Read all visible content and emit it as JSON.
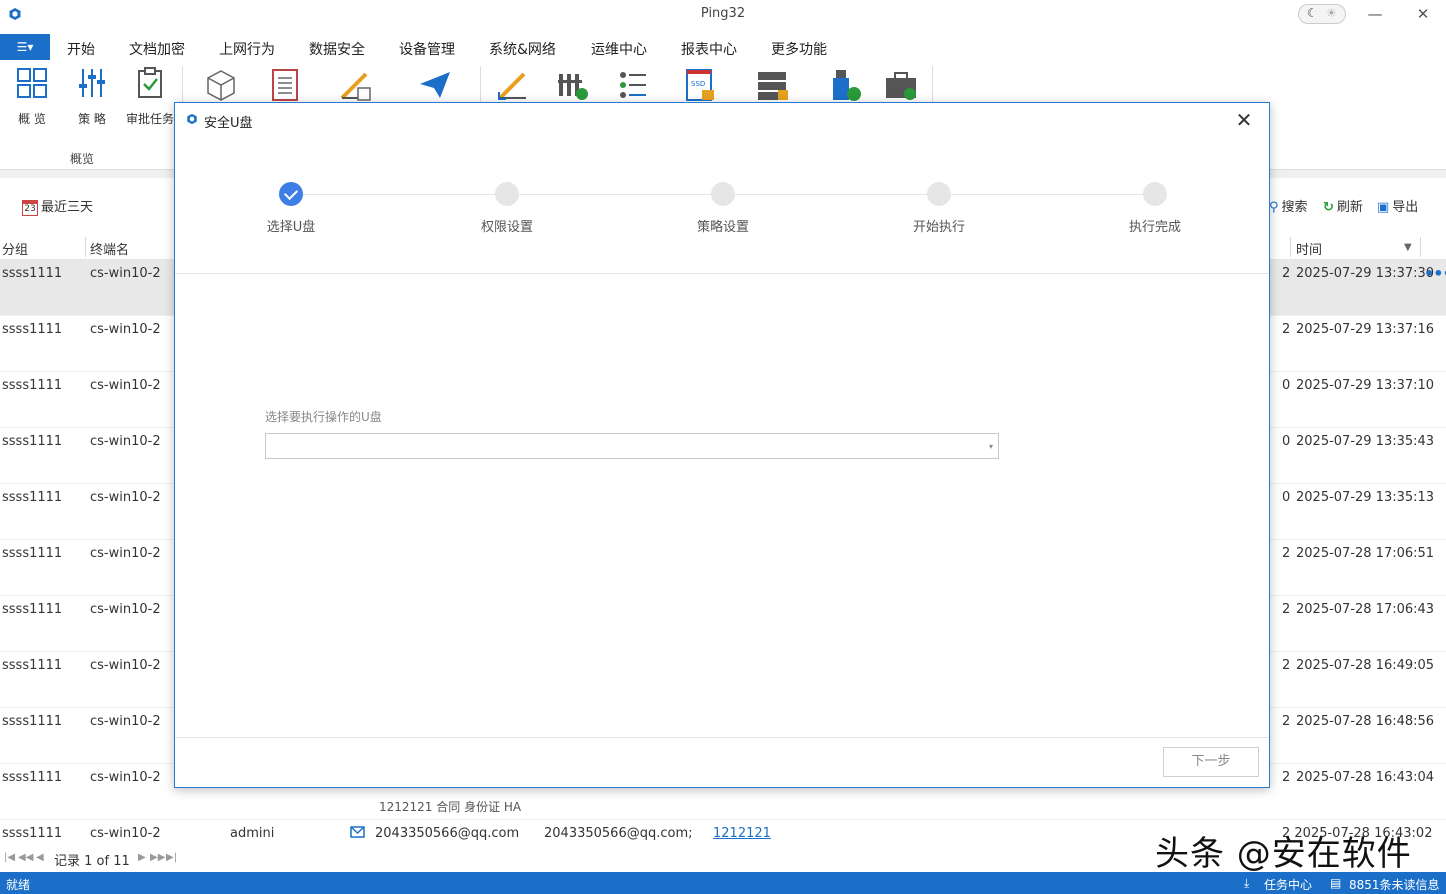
{
  "app": {
    "title": "Ping32"
  },
  "window": {
    "minimize": "—",
    "close": "✕"
  },
  "menu": {
    "app_button": "☰▾",
    "items": [
      "开始",
      "文档加密",
      "上网行为",
      "数据安全",
      "设备管理",
      "系统&网络",
      "运维中心",
      "报表中心",
      "更多功能"
    ],
    "active_index": 1
  },
  "ribbon": {
    "buttons": [
      {
        "label": "概 览",
        "icon": "grid-icon"
      },
      {
        "label": "策 略",
        "icon": "sliders-icon"
      },
      {
        "label": "审批任务",
        "icon": "clipboard-check-icon"
      }
    ],
    "group_label": "概览"
  },
  "toolbar": {
    "date_filter": "最近三天",
    "calendar_day": "23",
    "search": "搜索",
    "refresh": "刷新",
    "export": "导出"
  },
  "table": {
    "headers": {
      "group": "分组",
      "terminal": "终端名",
      "time": "时间"
    },
    "rows": [
      {
        "group": "ssss1111",
        "terminal": "cs-win10-2",
        "num": "2",
        "time": "2025-07-29 13:37:30"
      },
      {
        "group": "ssss1111",
        "terminal": "cs-win10-2",
        "num": "2",
        "time": "2025-07-29 13:37:16"
      },
      {
        "group": "ssss1111",
        "terminal": "cs-win10-2",
        "num": "0",
        "time": "2025-07-29 13:37:10"
      },
      {
        "group": "ssss1111",
        "terminal": "cs-win10-2",
        "num": "0",
        "time": "2025-07-29 13:35:43"
      },
      {
        "group": "ssss1111",
        "terminal": "cs-win10-2",
        "num": "0",
        "time": "2025-07-29 13:35:13"
      },
      {
        "group": "ssss1111",
        "terminal": "cs-win10-2",
        "num": "2",
        "time": "2025-07-28 17:06:51"
      },
      {
        "group": "ssss1111",
        "terminal": "cs-win10-2",
        "num": "2",
        "time": "2025-07-28 17:06:43"
      },
      {
        "group": "ssss1111",
        "terminal": "cs-win10-2",
        "num": "2",
        "time": "2025-07-28 16:49:05"
      },
      {
        "group": "ssss1111",
        "terminal": "cs-win10-2",
        "num": "2",
        "time": "2025-07-28 16:48:56"
      },
      {
        "group": "ssss1111",
        "terminal": "cs-win10-2",
        "num": "2",
        "time": "2025-07-28 16:43:04"
      }
    ],
    "row10_extra": "1212121 合同 身份证 HA",
    "last_row": {
      "group": "ssss1111",
      "terminal": "cs-win10-2",
      "user": "admini",
      "sender": "2043350566@qq.com",
      "receiver": "2043350566@qq.com;",
      "subject": "1212121",
      "time": "2 2025-07-28 16:43:02"
    },
    "more_icon": "•••"
  },
  "pager": {
    "text": "记录 1 of 11"
  },
  "status": {
    "left": "就绪",
    "task_center": "任务中心",
    "unread": "8851条未读信息"
  },
  "watermark": "头条 @安在软件",
  "dialog": {
    "title": "安全U盘",
    "steps": [
      "选择U盘",
      "权限设置",
      "策略设置",
      "开始执行",
      "执行完成"
    ],
    "current_step": 1,
    "field_label": "选择要执行操作的U盘",
    "select_value": "",
    "next_button": "下一步"
  },
  "colors": {
    "accent": "#1c6fc8",
    "step_done": "#3d7fe6"
  }
}
